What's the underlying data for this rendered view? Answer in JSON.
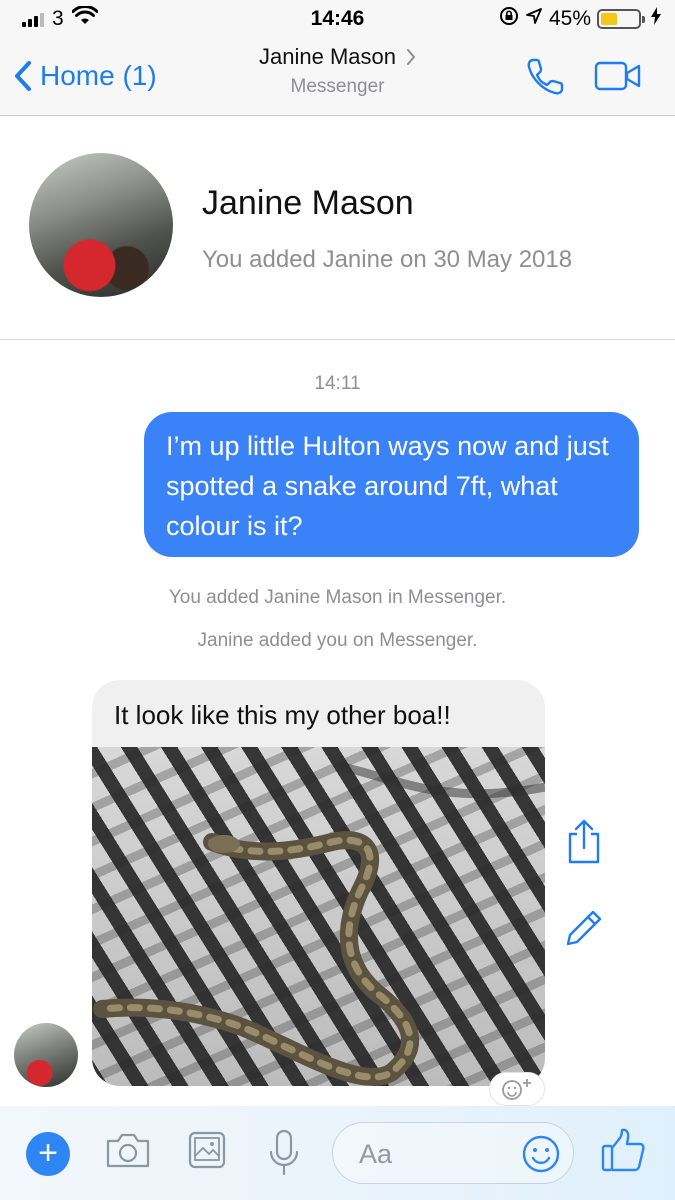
{
  "status_bar": {
    "carrier": "3",
    "time": "14:46",
    "battery": "45%",
    "battery_level": 0.45,
    "icons": [
      "signal-icon",
      "wifi-icon",
      "rotation-lock-icon",
      "location-icon",
      "battery-icon",
      "charging-icon"
    ]
  },
  "nav": {
    "back_label": "Home (1)",
    "title": "Janine Mason",
    "subtitle": "Messenger",
    "icons": [
      "back-chevron-icon",
      "chevron-right-icon",
      "phone-icon",
      "video-camera-icon"
    ]
  },
  "profile": {
    "name": "Janine Mason",
    "added_text": "You added Janine on 30 May 2018"
  },
  "conversation": {
    "timestamp": "14:11",
    "outgoing_message": "I’m up little Hulton ways now and just spotted a snake around 7ft, what colour is it?",
    "system_messages": [
      "You added Janine Mason in Messenger.",
      "Janine added you on Messenger."
    ],
    "incoming_message": "It look like this my other boa!!",
    "incoming_attachment": "snake-on-zebra-blanket-photo"
  },
  "actions": {
    "icons": [
      "share-icon",
      "edit-pencil-icon",
      "add-reaction-icon"
    ]
  },
  "composer": {
    "placeholder": "Aa",
    "icons": [
      "plus-icon",
      "camera-icon",
      "gallery-icon",
      "microphone-icon",
      "emoji-icon",
      "thumbs-up-icon"
    ]
  },
  "colors": {
    "accent": "#1e7cf2",
    "outgoing_bubble": "#3a82f7",
    "incoming_bubble": "#f0f0f0",
    "secondary_text": "#8e8e93"
  }
}
